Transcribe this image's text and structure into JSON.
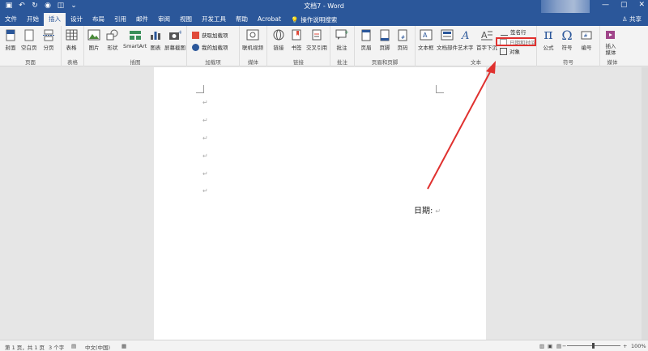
{
  "window": {
    "title": "文档7 - Word",
    "qat_icons": [
      "save-icon",
      "undo-icon",
      "redo-icon",
      "autosave-icon",
      "print-preview-icon",
      "qat-customize-icon"
    ],
    "controls": [
      "—",
      "▢",
      "✕"
    ]
  },
  "tabs": [
    {
      "label": "文件"
    },
    {
      "label": "开始"
    },
    {
      "label": "插入",
      "active": true
    },
    {
      "label": "设计"
    },
    {
      "label": "布局"
    },
    {
      "label": "引用"
    },
    {
      "label": "邮件"
    },
    {
      "label": "审阅"
    },
    {
      "label": "视图"
    },
    {
      "label": "开发工具"
    },
    {
      "label": "帮助"
    },
    {
      "label": "Acrobat"
    }
  ],
  "tellme": "操作说明搜索",
  "share": "共享",
  "ribbon": {
    "groups": {
      "pages": "页面",
      "tables": "表格",
      "illustrations": "插图",
      "addins": "加载项",
      "media": "媒体",
      "links": "链接",
      "comments": "批注",
      "header_footer": "页眉和页脚",
      "text": "文本",
      "symbols": "符号",
      "media2": "媒体"
    },
    "buttons": {
      "cover": "封面",
      "blank_page": "空白页",
      "page_break": "分页",
      "table": "表格",
      "picture": "图片",
      "shapes": "形状",
      "smartart": "SmartArt",
      "chart": "图表",
      "screenshot": "屏幕截图",
      "get_addins": "获取加载项",
      "my_addins": "我的加载项",
      "online_video": "联机视频",
      "link": "链接",
      "bookmark": "书签",
      "cross_ref": "交叉引用",
      "comment": "批注",
      "header": "页眉",
      "footer": "页脚",
      "page_number": "页码",
      "textbox": "文本框",
      "quick_parts": "文档部件",
      "wordart": "艺术字",
      "dropcap": "首字下沉",
      "signature": "签名行",
      "datetime": "日期和时间",
      "object": "对象",
      "equation": "公式",
      "symbol": "符号",
      "number": "编号",
      "embed_media": "插入媒体"
    }
  },
  "document": {
    "pilcrow": "↵",
    "date_label": "日期:"
  },
  "status": {
    "page": "第 1 页，共 1 页",
    "words": "3 个字",
    "language": "中文(中国)",
    "zoom": "100%"
  },
  "colors": {
    "titlebar": "#2b579a",
    "highlight": "#e0312f"
  }
}
